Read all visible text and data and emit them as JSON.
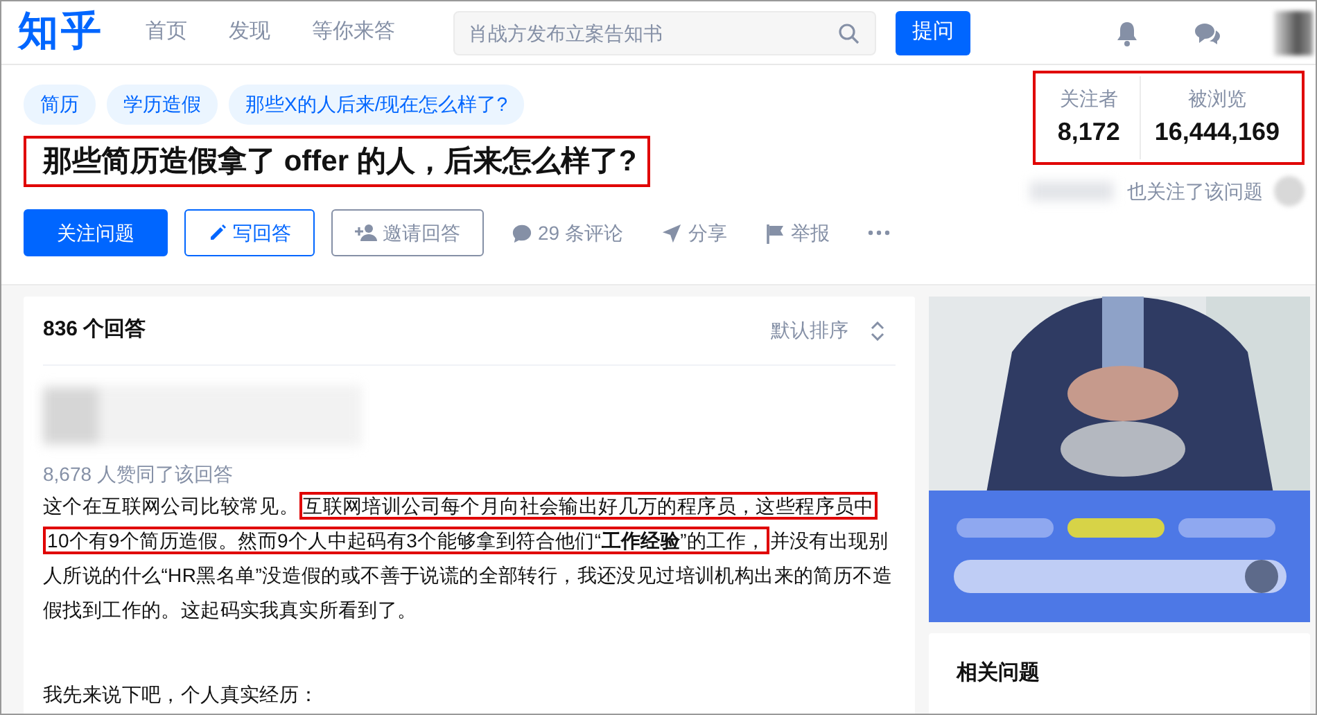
{
  "navbar": {
    "logo": "知乎",
    "links": [
      {
        "label": "首页",
        "selected": false
      },
      {
        "label": "发现",
        "selected": false
      },
      {
        "label": "等你来答",
        "selected": false
      }
    ],
    "search": {
      "placeholder": "肖战方发布立案告知书"
    },
    "ask_button": "提问"
  },
  "question": {
    "topics": [
      "简历",
      "学历造假",
      "那些X的人后来/现在怎么样了?"
    ],
    "title": "那些简历造假拿了 offer 的人，后来怎么样了?",
    "title_highlighted": true,
    "stats": {
      "highlighted": true,
      "items": [
        {
          "label": "关注者",
          "value": "8,172"
        },
        {
          "label": "被浏览",
          "value": "16,444,169"
        }
      ]
    },
    "also_followed": "也关注了该问题",
    "actions": [
      {
        "kind": "follow",
        "label": "关注问题"
      },
      {
        "kind": "write",
        "label": "写回答"
      },
      {
        "kind": "invite",
        "label": "邀请回答"
      },
      {
        "kind": "comment",
        "label": "29 条评论"
      },
      {
        "kind": "share",
        "label": "分享"
      },
      {
        "kind": "report",
        "label": "举报"
      },
      {
        "kind": "more"
      }
    ]
  },
  "answers": {
    "count": "836 个回答",
    "sort": "默认排序",
    "votes": "8,678 人赞同了该回答",
    "paragraphs": [
      [
        {
          "text": "这个在互联网公司比较常见。",
          "highlighted": false
        },
        {
          "text": "互联网培训公司每个月向社会输出好几万的程序员，这些程序员中10个有9个简历造假。然而9个人中起码有3个能够拿到符合他们“**工作经验**”的工作，",
          "highlighted": true
        },
        {
          "text": "并没有出现别人所说的什么“HR黑名单”没造假的或不善于说谎的全部转行，我还没见过培训机构出来的简历不造假找到工作的。这起码实我真实所看到了。",
          "highlighted": false
        }
      ],
      [
        {
          "text": "我先来说下吧，个人真实经历：",
          "highlighted": false
        }
      ]
    ]
  },
  "sidebar": {
    "related_title": "相关问题"
  }
}
